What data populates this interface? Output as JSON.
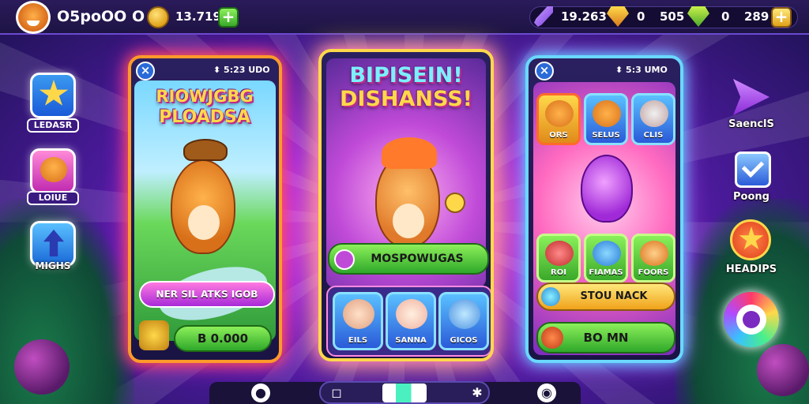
{
  "topbar": {
    "player_name": "O5poOO O",
    "coins": "13.719",
    "plus_label": "+",
    "res1": "19.263",
    "res2_prefix": "0",
    "res2": "505",
    "res3_prefix": "0",
    "res3": "289",
    "plus2_label": "+"
  },
  "left_sidebar": [
    {
      "label": "LEDASR"
    },
    {
      "label": "LOIUE"
    },
    {
      "label": "MIGHS"
    }
  ],
  "right_sidebar": [
    {
      "label": "SaenclS"
    },
    {
      "label": "Poong"
    },
    {
      "label": "HEADIPS"
    }
  ],
  "card_left": {
    "close": "×",
    "timer": "⬍ 5:23 UDO",
    "title_line1": "RIOWJGBG",
    "title_line2": "PLOADSA",
    "offer_label": "NER SIL ATKS IGOB",
    "price": "B 0.000"
  },
  "card_mid": {
    "title_line1": "BIPISEIN!",
    "title_line2": "DISHANSS!",
    "action_label": "MOSPOWUGAS",
    "characters": [
      {
        "name": "EILS"
      },
      {
        "name": "SANNA"
      },
      {
        "name": "GICOS"
      }
    ]
  },
  "card_right": {
    "close": "×",
    "timer": "⬍ 5:3 UMO",
    "top_items": [
      {
        "name": "ORS"
      },
      {
        "name": "SELUS"
      },
      {
        "name": "CLIS"
      }
    ],
    "bottom_items": [
      {
        "name": "ROI"
      },
      {
        "name": "FIAMAS"
      },
      {
        "name": "FOORS"
      }
    ],
    "stock_label": "STOU NACK",
    "buy_label": "BO MN"
  },
  "colors": {
    "accent_orange": "#ff9a2a",
    "accent_yellow": "#ffd84a",
    "accent_cyan": "#6ad8ff",
    "button_green": "#3aa82a"
  }
}
